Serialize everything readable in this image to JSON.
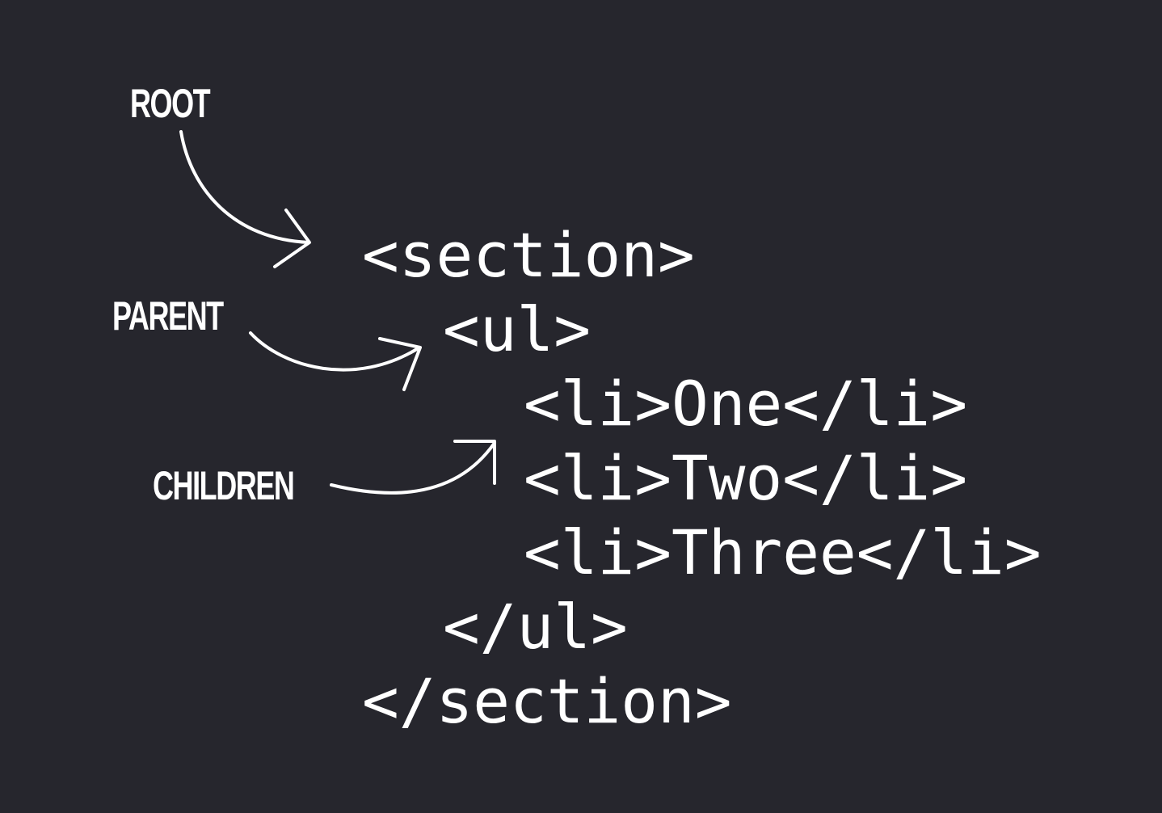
{
  "labels": {
    "root": "ROOT",
    "parent": "PARENT",
    "children": "CHILDREN"
  },
  "code": {
    "lines": [
      "<section>",
      "<ul>",
      "<li>One</li>",
      "<li>Two</li>",
      "<li>Three</li>",
      "</ul>",
      "</section>"
    ]
  },
  "colors": {
    "background": "#26262d",
    "foreground": "#ffffff"
  }
}
